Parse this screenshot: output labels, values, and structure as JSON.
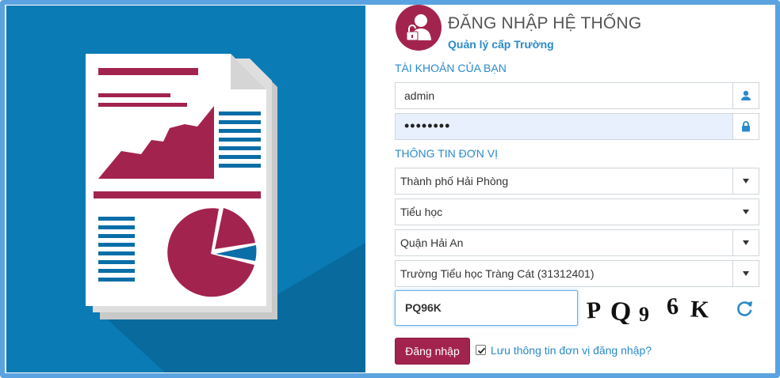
{
  "header": {
    "title": "ĐĂNG NHẬP HỆ THỐNG",
    "subtitle": "Quản lý cấp Trường"
  },
  "account": {
    "section_label": "TÀI KHOẢN CỦA BẠN",
    "username": "admin",
    "password_masked": "••••••••"
  },
  "unit": {
    "section_label": "THÔNG TIN ĐƠN VỊ",
    "city": "Thành phố Hải Phòng",
    "level": "Tiểu học",
    "district": "Quận Hải An",
    "school": "Trường Tiểu học Tràng Cát (31312401)"
  },
  "captcha": {
    "input_value": "PQ96K",
    "image_chars": [
      "P",
      "Q",
      "9",
      "6",
      "K"
    ]
  },
  "actions": {
    "login_label": "Đăng nhập",
    "remember_label": "Lưu thông tin đơn vị đăng nhập?",
    "remember_checked": true
  },
  "colors": {
    "brand": "#a2244e",
    "accent": "#2a8acb",
    "hero_bg": "#0a7bb5",
    "frame": "#5aa3e0"
  }
}
